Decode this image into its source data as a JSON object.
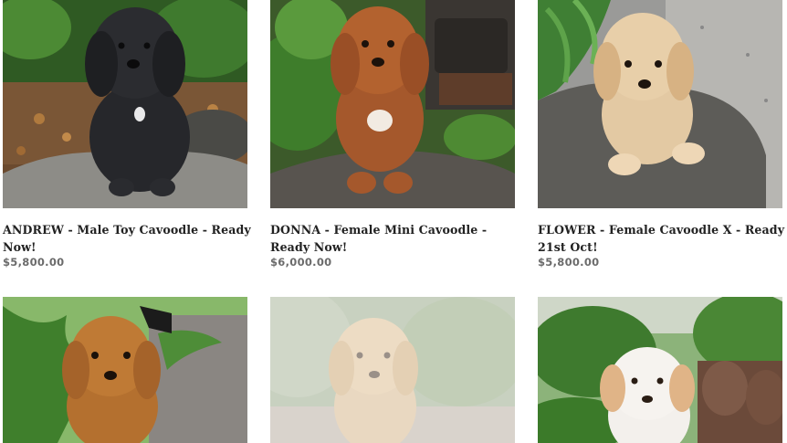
{
  "products": [
    {
      "title": "ANDREW - Male Toy Cavoodle - Ready Now!",
      "price": "$5,800.00",
      "coat": "black"
    },
    {
      "title": "DONNA - Female Mini Cavoodle - Ready Now!",
      "price": "$6,000.00",
      "coat": "red"
    },
    {
      "title": "FLOWER - Female Cavoodle X - Ready 21st Oct!",
      "price": "$5,800.00",
      "coat": "apricot"
    },
    {
      "title": "",
      "price": "",
      "coat": "red"
    },
    {
      "title": "",
      "price": "",
      "coat": "apricot-faded"
    },
    {
      "title": "",
      "price": "",
      "coat": "white"
    }
  ]
}
